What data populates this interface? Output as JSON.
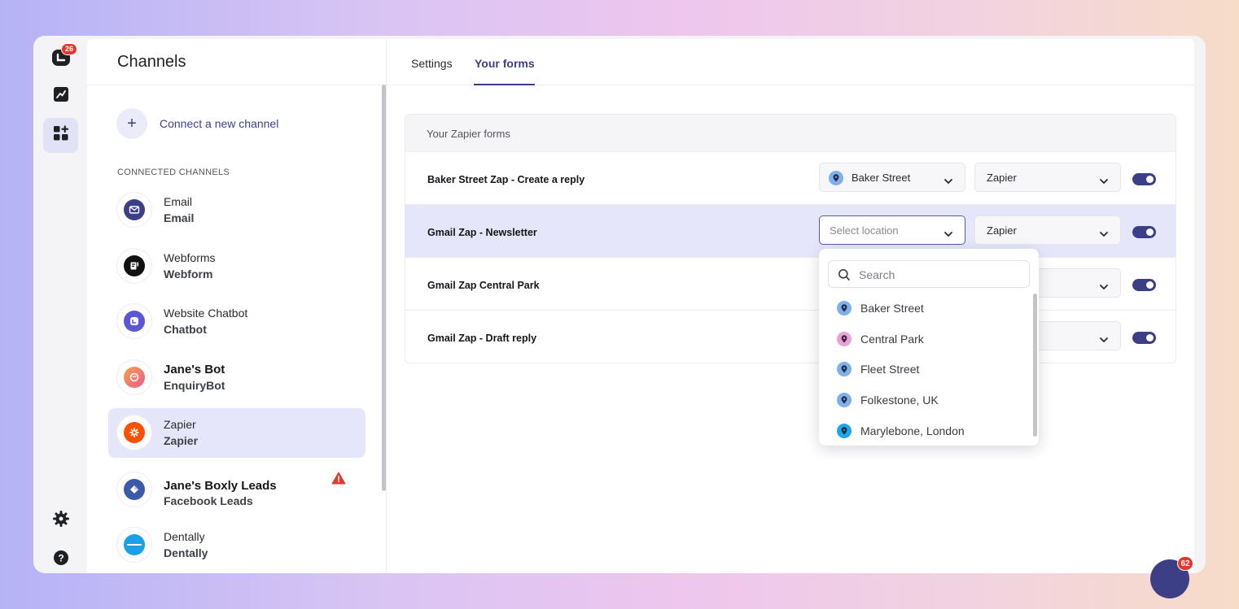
{
  "rail": {
    "badge_count": "26",
    "items": [
      "logo-icon",
      "reports-icon",
      "channels-icon",
      "settings-icon",
      "help-icon"
    ]
  },
  "channels_panel": {
    "title": "Channels",
    "connect_label": "Connect a new channel",
    "section_label": "CONNECTED CHANNELS",
    "items": [
      {
        "name": "Email",
        "sub": "Email",
        "icon": "email-icon",
        "color": "#3d3f86"
      },
      {
        "name": "Webforms",
        "sub": "Webform",
        "icon": "webform-icon",
        "color": "#111111"
      },
      {
        "name": "Website Chatbot",
        "sub": "Chatbot",
        "icon": "chatbot-icon",
        "color": "#5b56d6"
      },
      {
        "name": "Jane's Bot",
        "sub": "EnquiryBot",
        "icon": "enquirybot-icon",
        "color": "#f07a6a"
      },
      {
        "name": "Zapier",
        "sub": "Zapier",
        "icon": "zapier-icon",
        "color": "#ff4f00"
      },
      {
        "name": "Jane's Boxly Leads",
        "sub": "Facebook Leads",
        "icon": "boxly-icon",
        "color": "#3a5ba8"
      },
      {
        "name": "Dentally",
        "sub": "Dentally",
        "icon": "dentally-icon",
        "color": "#1aa0e6"
      }
    ]
  },
  "tabs": [
    {
      "label": "Settings"
    },
    {
      "label": "Your forms"
    }
  ],
  "forms": {
    "header": "Your Zapier forms",
    "rows": [
      {
        "name": "Baker Street Zap - Create a reply",
        "location": "Baker Street",
        "app": "Zapier",
        "enabled": true
      },
      {
        "name": "Gmail Zap - Newsletter",
        "location_placeholder": "Select location",
        "app": "Zapier",
        "enabled": true
      },
      {
        "name": "Gmail Zap Central Park",
        "enabled": true
      },
      {
        "name": "Gmail Zap - Draft reply",
        "enabled": true
      }
    ]
  },
  "dropdown": {
    "search_placeholder": "Search",
    "options": [
      {
        "label": "Baker Street",
        "color": "#7fb0e8"
      },
      {
        "label": "Central Park",
        "color": "#e8a2d8"
      },
      {
        "label": "Fleet Street",
        "color": "#7fb0e8"
      },
      {
        "label": "Folkestone, UK",
        "color": "#7fb0e8"
      },
      {
        "label": "Marylebone, London",
        "color": "#1fa6e8"
      }
    ]
  },
  "chat": {
    "badge_count": "62"
  }
}
